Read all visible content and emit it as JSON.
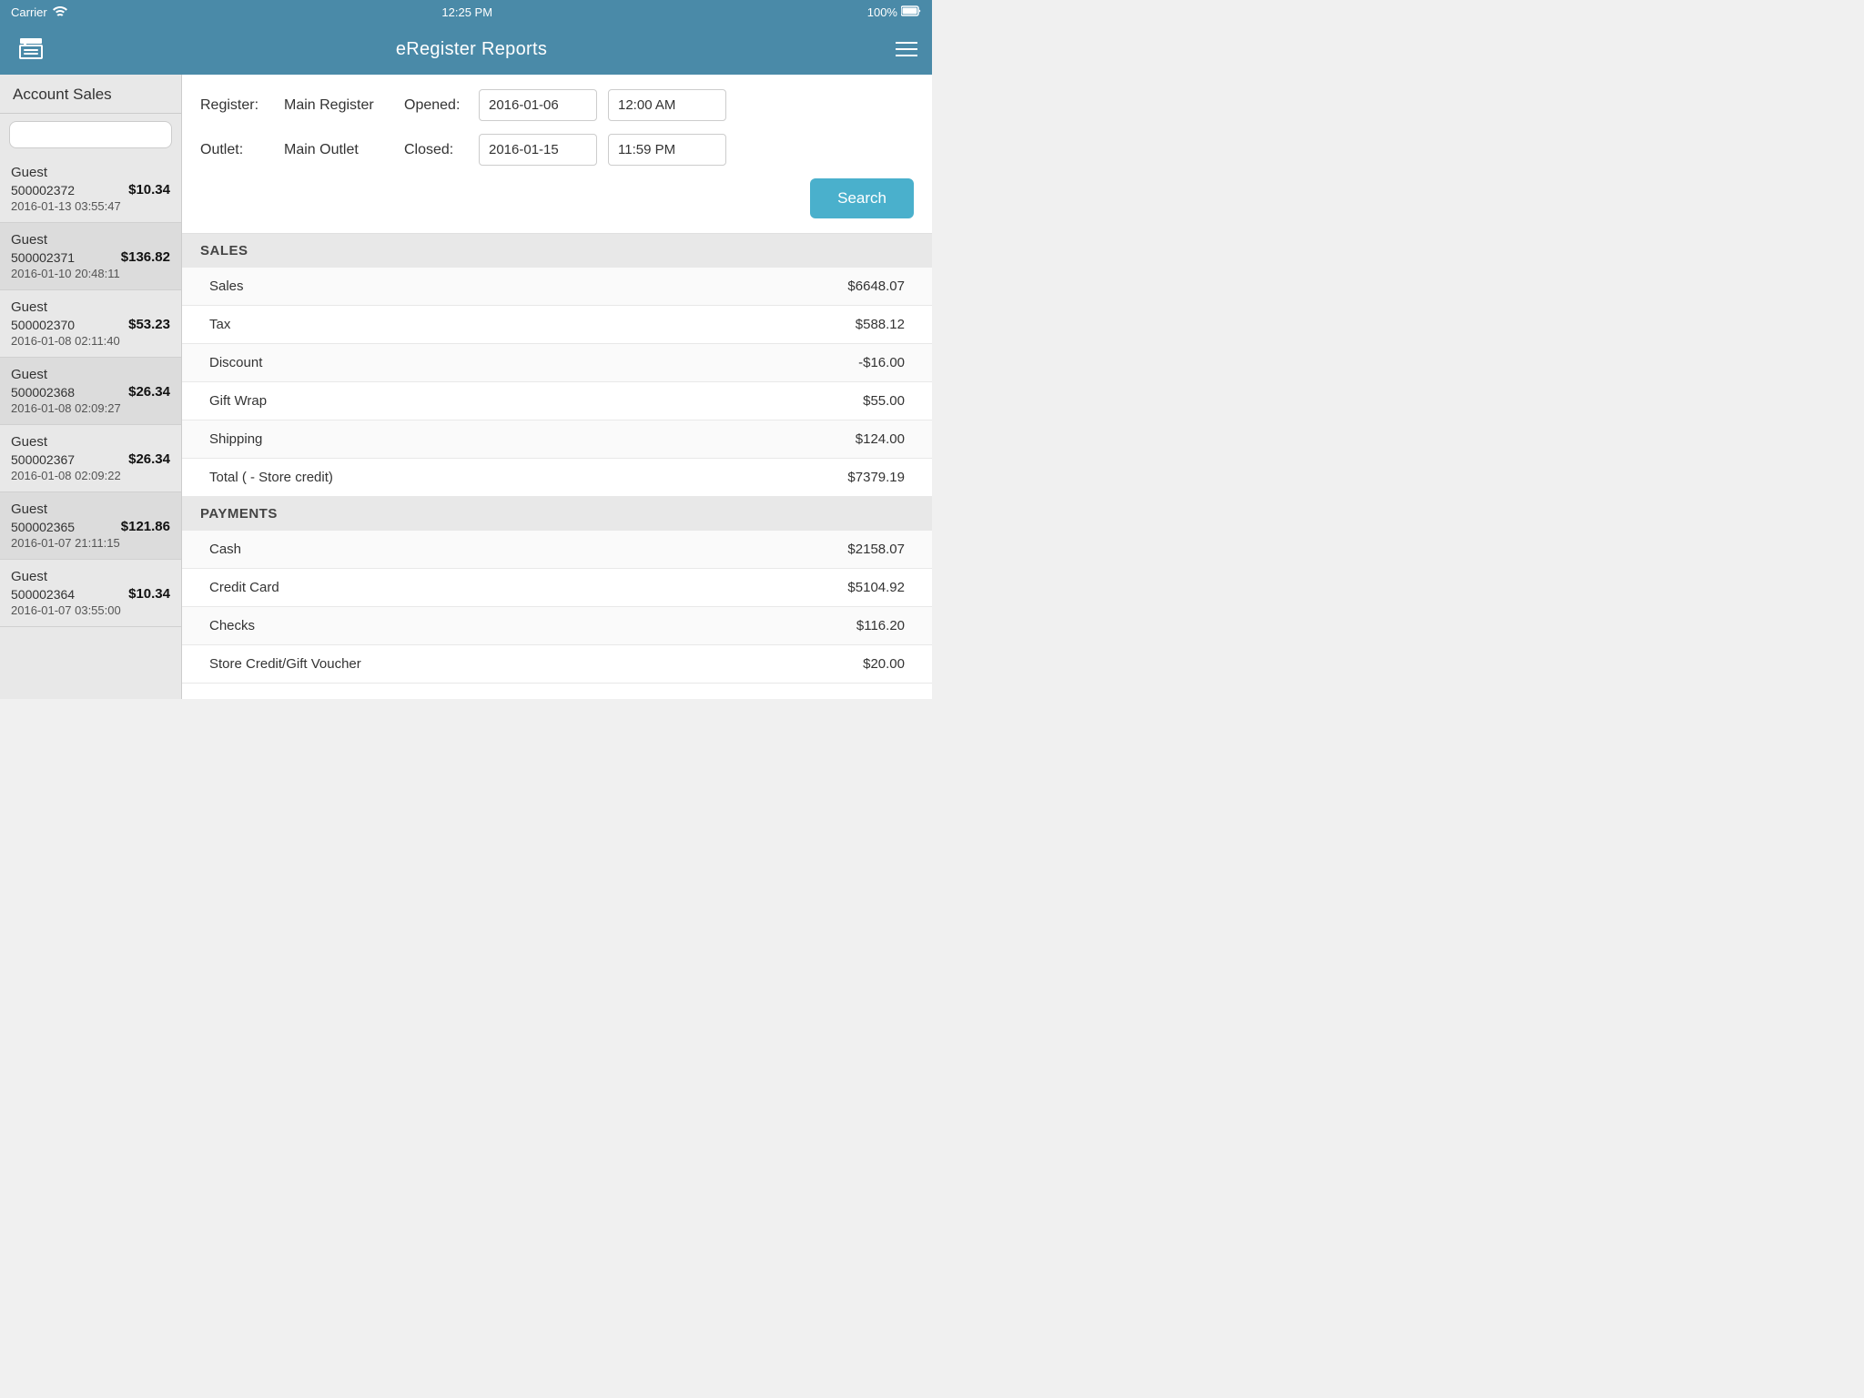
{
  "statusBar": {
    "carrier": "Carrier",
    "time": "12:25 PM",
    "battery": "100%"
  },
  "header": {
    "title": "eRegister Reports"
  },
  "sidebar": {
    "title": "Account Sales",
    "search": {
      "placeholder": ""
    },
    "items": [
      {
        "name": "Guest",
        "id": "500002372",
        "amount": "$10.34",
        "date": "2016-01-13 03:55:47"
      },
      {
        "name": "Guest",
        "id": "500002371",
        "amount": "$136.82",
        "date": "2016-01-10 20:48:11"
      },
      {
        "name": "Guest",
        "id": "500002370",
        "amount": "$53.23",
        "date": "2016-01-08 02:11:40"
      },
      {
        "name": "Guest",
        "id": "500002368",
        "amount": "$26.34",
        "date": "2016-01-08 02:09:27"
      },
      {
        "name": "Guest",
        "id": "500002367",
        "amount": "$26.34",
        "date": "2016-01-08 02:09:22"
      },
      {
        "name": "Guest",
        "id": "500002365",
        "amount": "$121.86",
        "date": "2016-01-07 21:11:15"
      },
      {
        "name": "Guest",
        "id": "500002364",
        "amount": "$10.34",
        "date": "2016-01-07 03:55:00"
      }
    ]
  },
  "filters": {
    "register_label": "Register:",
    "register_value": "Main Register",
    "opened_label": "Opened:",
    "opened_date": "2016-01-06",
    "opened_time": "12:00 AM",
    "outlet_label": "Outlet:",
    "outlet_value": "Main Outlet",
    "closed_label": "Closed:",
    "closed_date": "2016-01-15",
    "closed_time": "11:59 PM",
    "search_button": "Search"
  },
  "sales": {
    "section_label": "SALES",
    "rows": [
      {
        "label": "Sales",
        "value": "$6648.07"
      },
      {
        "label": "Tax",
        "value": "$588.12"
      },
      {
        "label": "Discount",
        "value": "-$16.00"
      },
      {
        "label": "Gift Wrap",
        "value": "$55.00"
      },
      {
        "label": "Shipping",
        "value": "$124.00"
      },
      {
        "label": "Total ( - Store credit)",
        "value": "$7379.19"
      }
    ]
  },
  "payments": {
    "section_label": "PAYMENTS",
    "rows": [
      {
        "label": "Cash",
        "value": "$2158.07"
      },
      {
        "label": "Credit Card",
        "value": "$5104.92"
      },
      {
        "label": "Checks",
        "value": "$116.20"
      },
      {
        "label": "Store Credit/Gift Voucher",
        "value": "$20.00"
      }
    ]
  }
}
